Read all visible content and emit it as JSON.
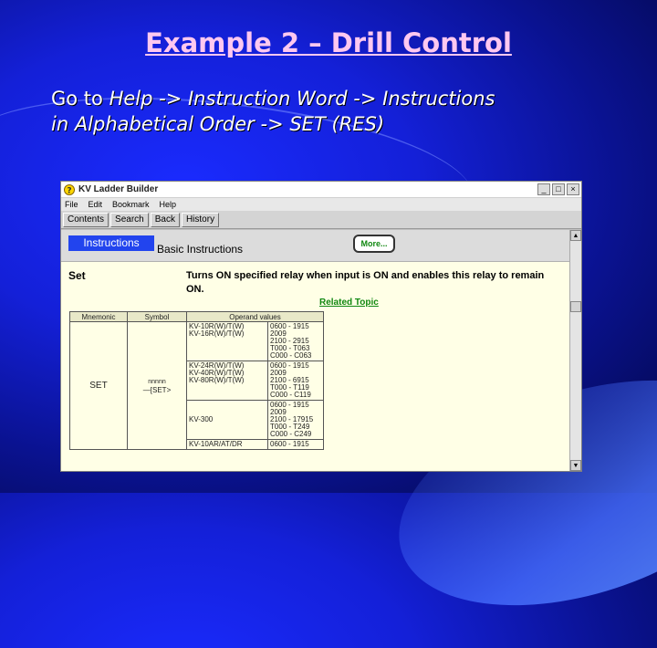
{
  "slide": {
    "title": "Example 2 – Drill Control",
    "line1_a": "Go to ",
    "line1_b": "Help -> Instruction Word -> Instructions",
    "line2": "in Alphabetical Order -> SET  (RES)"
  },
  "window": {
    "title": "KV Ladder Builder",
    "controls": {
      "minimize": "_",
      "maximize": "□",
      "close": "×"
    },
    "menu": [
      "File",
      "Edit",
      "Bookmark",
      "Help"
    ],
    "toolbar": [
      "Contents",
      "Search",
      "Back",
      "History"
    ],
    "tab_label": "Instructions",
    "section_title": "Basic Instructions",
    "more_button": "More...",
    "instruction_name": "Set",
    "description": "Turns ON specified relay when input is ON and enables this relay to remain ON.",
    "related_topic": "Related Topic",
    "table": {
      "headers": [
        "Mnemonic",
        "Symbol",
        "Operand values"
      ],
      "mnemonic": "SET",
      "symbol_top": "nnnnn",
      "symbol_main": "SET",
      "rows": [
        {
          "models": [
            "KV-10R(W)/T(W)",
            "KV-16R(W)/T(W)"
          ],
          "values": [
            "0600 - 1915",
            "2009",
            "2100 - 2915",
            "T000 - T063",
            "C000 - C063"
          ]
        },
        {
          "models": [
            "KV-24R(W)/T(W)",
            "KV-40R(W)/T(W)",
            "KV-80R(W)/T(W)"
          ],
          "values": [
            "0600 - 1915",
            "2009",
            "2100 - 6915",
            "T000 - T119",
            "C000 - C119"
          ]
        },
        {
          "models": [
            "KV-300"
          ],
          "values": [
            "0600 - 1915",
            "2009",
            "2100 - 17915",
            "T000 - T249",
            "C000 - C249"
          ]
        },
        {
          "models": [
            "KV-10AR/AT/DR"
          ],
          "values": [
            "0600 - 1915"
          ]
        }
      ]
    },
    "scroll": {
      "up": "▲",
      "down": "▼"
    }
  }
}
